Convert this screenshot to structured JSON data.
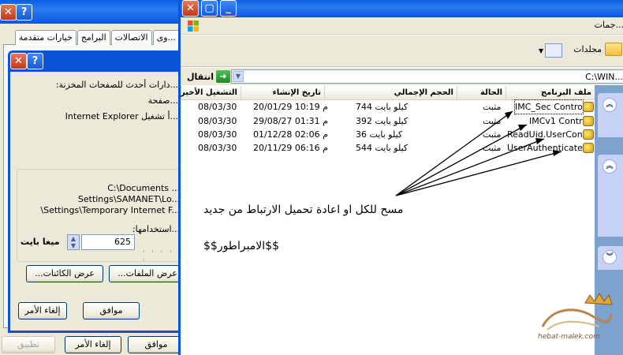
{
  "back_window": {
    "tabs": [
      "خيارات متقدمة",
      "البرامج",
      "الاتصالات",
      "...وى"
    ],
    "buttons": {
      "ok": "موافق",
      "cancel": "إلغاء الأمر",
      "apply": "تطبيق"
    }
  },
  "dialog": {
    "line1": "...دارات أحدث للصفحات المخزنة:",
    "line2": "...صفحة",
    "line3": "...أ تشغيل Internet Explorer",
    "paths": [
      "C:\\Documents ...",
      "Settings\\SAMANET\\Lo...",
      "\\Settings\\Temporary Internet F..."
    ],
    "usage_label": "...استخدامها:",
    "disk_value": "625",
    "unit_label": "ميغا بايت",
    "buttons": {
      "view_objects": "عرض الكائنات...",
      "view_files": "عرض الملفات...",
      "ok": "موافق",
      "cancel": "إلغاء الأمر"
    }
  },
  "explorer": {
    "menu_title": "...جمات",
    "toolbar": {
      "folders": "مجلدات"
    },
    "address": {
      "go": "انتقال",
      "path": "C:\\WIN..."
    },
    "columns": {
      "name": "ملف البرنامج",
      "status": "الحالة",
      "size": "الحجم الإجمالي",
      "created": "تاريخ الإنشاء",
      "last_run": "التشغيل الأخير"
    },
    "rows": [
      {
        "name": "IMC_Sec Control",
        "status": "مثبت",
        "size": "كيلو بايت 744",
        "created": "م 10:19 20/01/29",
        "last_run": "08/03/30"
      },
      {
        "name": "IMCv1 Control",
        "status": "مثبت",
        "size": "كيلو بايت 392",
        "created": "م 01:31 29/08/27",
        "last_run": "08/03/30"
      },
      {
        "name": "ReadUid.UserCon...",
        "status": "مثبت",
        "size": "كيلو بايت 36",
        "created": "م 02:06 01/12/28",
        "last_run": "08/03/30"
      },
      {
        "name": "UserAuthenticate ...",
        "status": "مثبت",
        "size": "كيلو بايت 544",
        "created": "م 06:16 20/11/29",
        "last_run": "08/03/30"
      }
    ]
  },
  "annotation": {
    "main": "مسح للكل او اعادة تحميل الارتباط من جديد",
    "signature": "$$الامبراطور$$"
  },
  "watermark": {
    "site": "hebat-malek.com"
  },
  "colors": {
    "xp_blue": "#0b55d8",
    "panel_blue": "#7da2ce",
    "face": "#ece9d8"
  }
}
